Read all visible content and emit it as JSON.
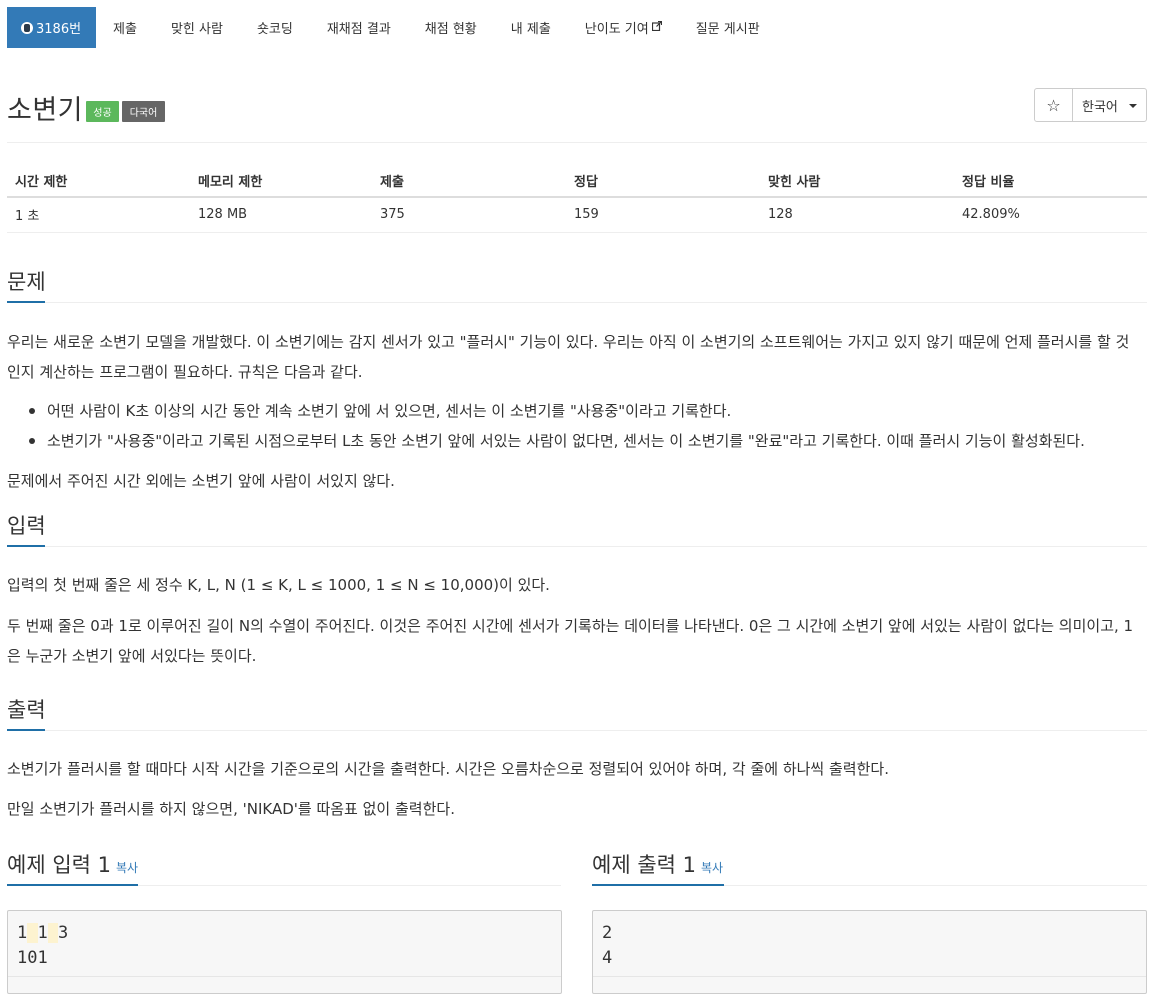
{
  "nav": {
    "problem_tab": "3186번",
    "tabs": [
      "제출",
      "맞힌 사람",
      "숏코딩",
      "재채점 결과",
      "채점 현황",
      "내 제출",
      "난이도 기여",
      "질문 게시판"
    ]
  },
  "problem": {
    "title": "소변기",
    "labels": {
      "success": "성공",
      "multilang": "다국어"
    },
    "language": "한국어",
    "star": "☆"
  },
  "info": {
    "headers": [
      "시간 제한",
      "메모리 제한",
      "제출",
      "정답",
      "맞힌 사람",
      "정답 비율"
    ],
    "values": [
      "1 초",
      "128 MB",
      "375",
      "159",
      "128",
      "42.809%"
    ]
  },
  "sections": {
    "problem_heading": "문제",
    "problem_p1": "우리는 새로운 소변기 모델을 개발했다. 이 소변기에는 감지 센서가 있고 \"플러시\" 기능이 있다. 우리는 아직 이 소변기의 소프트웨어는 가지고 있지 않기 때문에 언제 플러시를 할 것인지 계산하는 프로그램이 필요하다. 규칙은 다음과 같다.",
    "rules": [
      "어떤 사람이 K초 이상의 시간 동안 계속 소변기 앞에 서 있으면, 센서는 이 소변기를 \"사용중\"이라고 기록한다.",
      "소변기가 \"사용중\"이라고 기록된 시점으로부터 L초 동안 소변기 앞에 서있는 사람이 없다면, 센서는 이 소변기를 \"완료\"라고 기록한다. 이때 플러시 기능이 활성화된다."
    ],
    "problem_p2": "문제에서 주어진 시간 외에는 소변기 앞에 사람이 서있지 않다.",
    "input_heading": "입력",
    "input_p1": "입력의 첫 번째 줄은 세 정수 K, L, N (1 ≤ K, L ≤ 1000, 1 ≤ N ≤ 10,000)이 있다.",
    "input_p2": "두 번째 줄은 0과 1로 이루어진 길이 N의 수열이 주어진다. 이것은 주어진 시간에 센서가 기록하는 데이터를 나타낸다. 0은 그 시간에 소변기 앞에 서있는 사람이 없다는 의미이고, 1은 누군가 소변기 앞에 서있다는 뜻이다.",
    "output_heading": "출력",
    "output_p1": "소변기가 플러시를 할 때마다 시작 시간을 기준으로의 시간을 출력한다. 시간은 오름차순으로 정렬되어 있어야 하며, 각 줄에 하나씩 출력한다.",
    "output_p2": "만일 소변기가 플러시를 하지 않으면, 'NIKAD'를 따옴표 없이 출력한다."
  },
  "samples": {
    "input_heading": "예제 입력 1",
    "output_heading": "예제 출력 1",
    "copy_label": "복사",
    "input_line1": [
      "1",
      "1",
      "3"
    ],
    "input_line2": "101",
    "output_lines": [
      "2",
      "4"
    ]
  }
}
